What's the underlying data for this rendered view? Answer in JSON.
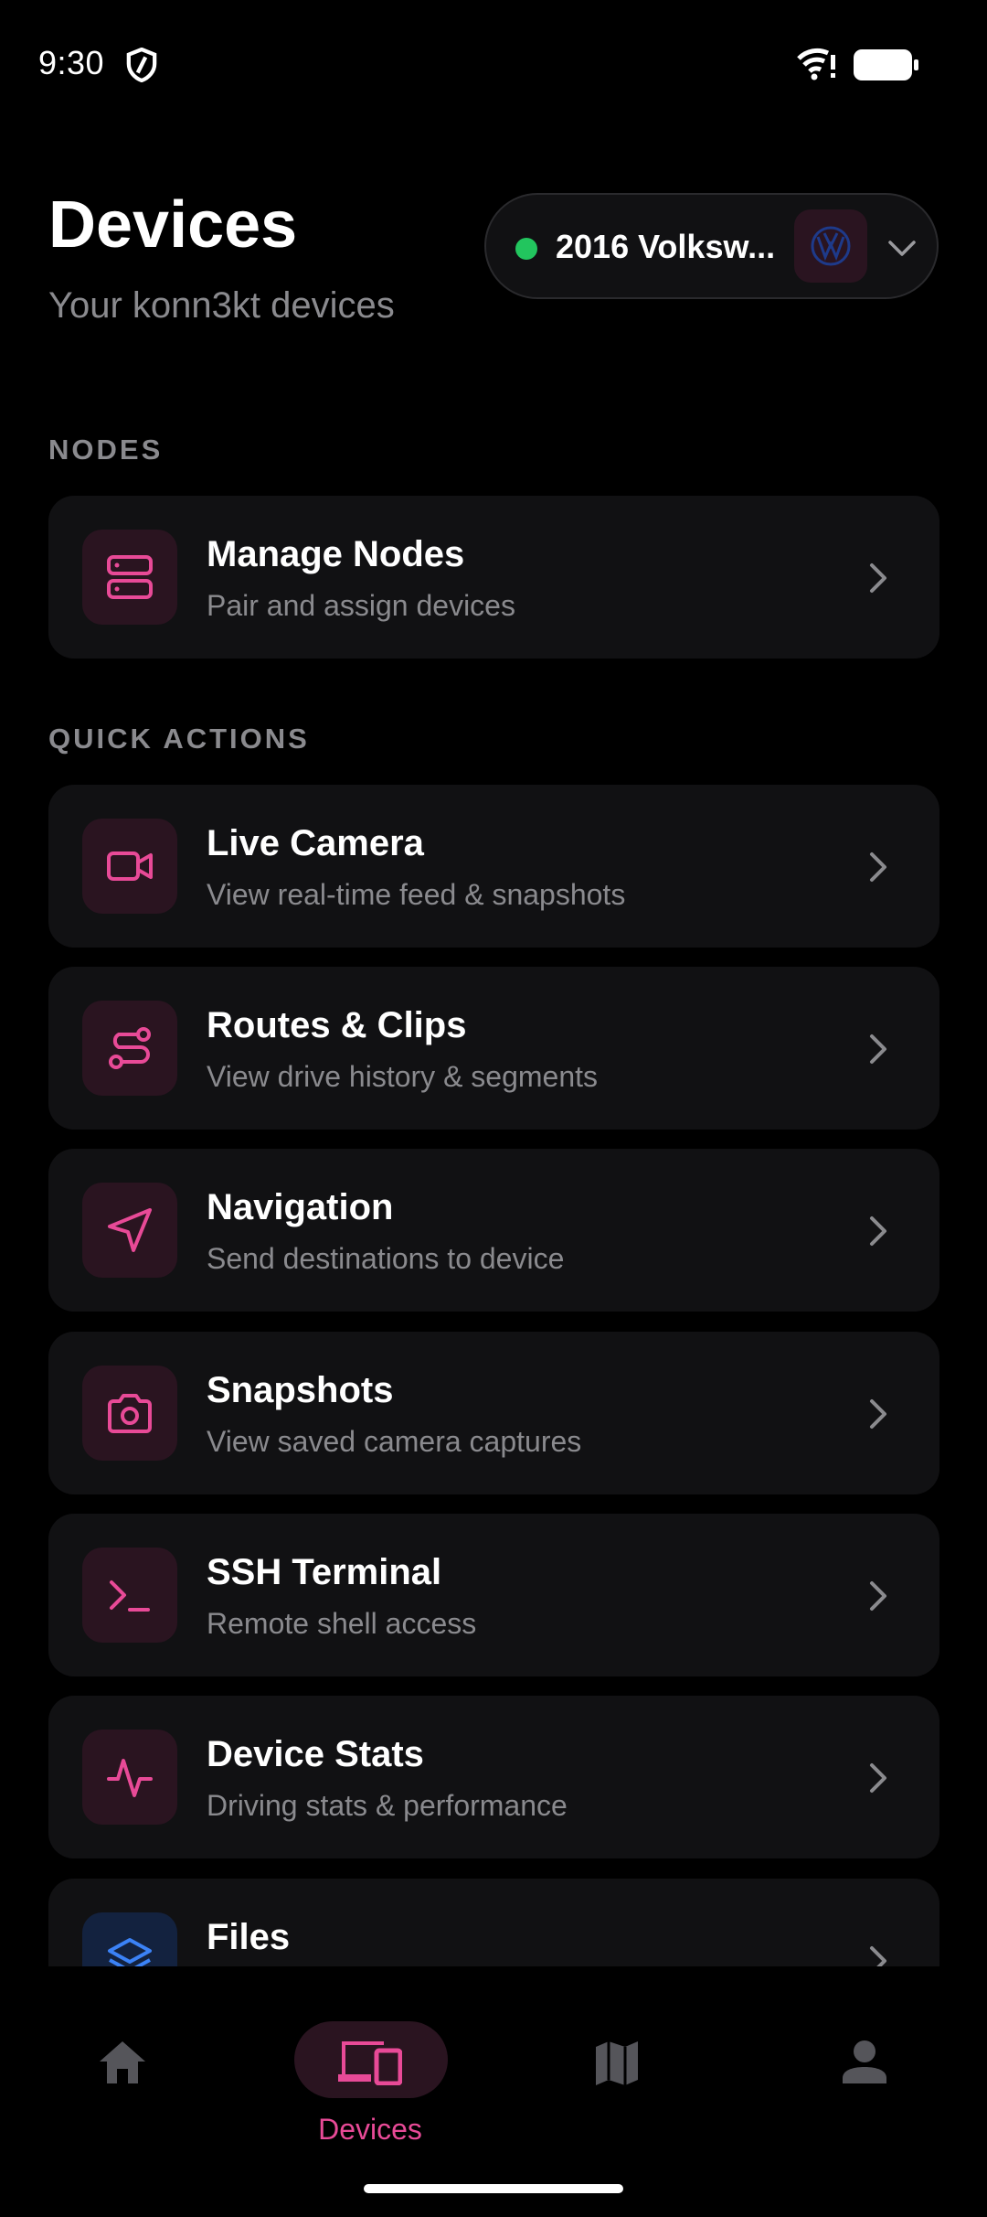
{
  "status_bar": {
    "time": "9:30"
  },
  "header": {
    "title": "Devices",
    "subtitle": "Your konn3kt devices"
  },
  "vehicle_selector": {
    "name": "2016 Volksw...",
    "status_color": "#22c55e"
  },
  "sections": {
    "nodes_label": "NODES",
    "quick_actions_label": "QUICK ACTIONS"
  },
  "nodes": [
    {
      "title": "Manage Nodes",
      "subtitle": "Pair and assign devices",
      "icon": "server-icon"
    }
  ],
  "quick_actions": [
    {
      "title": "Live Camera",
      "subtitle": "View real-time feed & snapshots",
      "icon": "video-camera-icon"
    },
    {
      "title": "Routes & Clips",
      "subtitle": "View drive history & segments",
      "icon": "route-icon"
    },
    {
      "title": "Navigation",
      "subtitle": "Send destinations to device",
      "icon": "navigation-arrow-icon"
    },
    {
      "title": "Snapshots",
      "subtitle": "View saved camera captures",
      "icon": "camera-icon"
    },
    {
      "title": "SSH Terminal",
      "subtitle": "Remote shell access",
      "icon": "terminal-icon"
    },
    {
      "title": "Device Stats",
      "subtitle": "Driving stats & performance",
      "icon": "activity-icon"
    },
    {
      "title": "Files",
      "subtitle": "",
      "icon": "layers-icon"
    }
  ],
  "bottom_nav": {
    "items": [
      {
        "label": "",
        "icon": "home-icon"
      },
      {
        "label": "Devices",
        "icon": "devices-icon",
        "active": true
      },
      {
        "label": "",
        "icon": "map-icon"
      },
      {
        "label": "",
        "icon": "person-icon"
      }
    ]
  },
  "colors": {
    "accent": "#e84a97",
    "background": "#000000",
    "card": "#111113",
    "muted_text": "#8a8a8e",
    "online": "#22c55e",
    "files_accent": "#3b82f6"
  }
}
